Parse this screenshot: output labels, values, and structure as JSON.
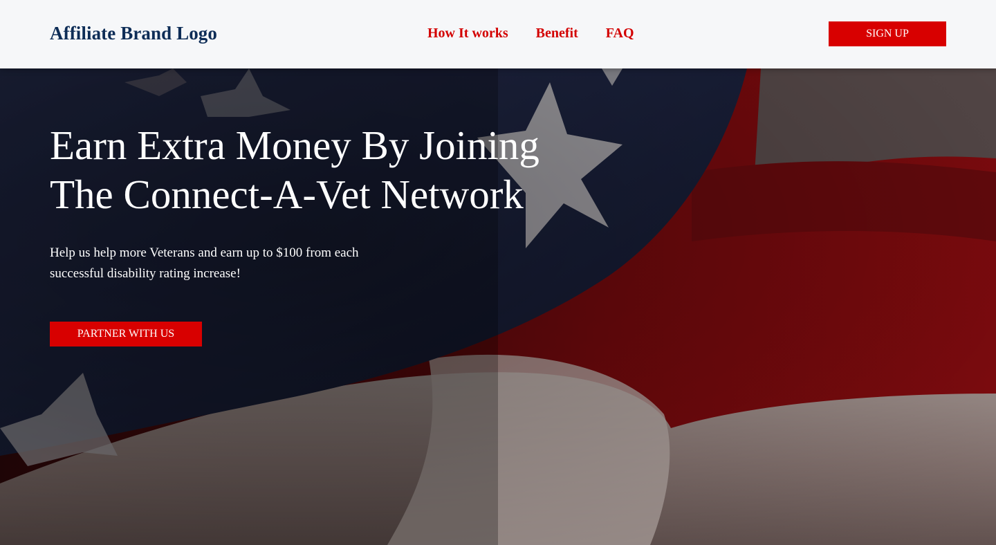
{
  "nav": {
    "logo": "Affiliate Brand Logo",
    "links": [
      "How It works",
      "Benefit",
      "FAQ"
    ],
    "signup_label": "SIGN UP"
  },
  "hero": {
    "headline_line1": "Earn Extra Money By Joining",
    "headline_line2": "The Connect-A-Vet Network",
    "subtext_line1": "Help us help more Veterans and earn up to $100 from each",
    "subtext_line2": "successful disability rating increase!",
    "cta_label": "PARTNER WITH US",
    "background": "american-flag-image"
  },
  "colors": {
    "accent": "#d80000",
    "brand": "#0e2d57",
    "nav_bg": "#f6f7f9"
  }
}
